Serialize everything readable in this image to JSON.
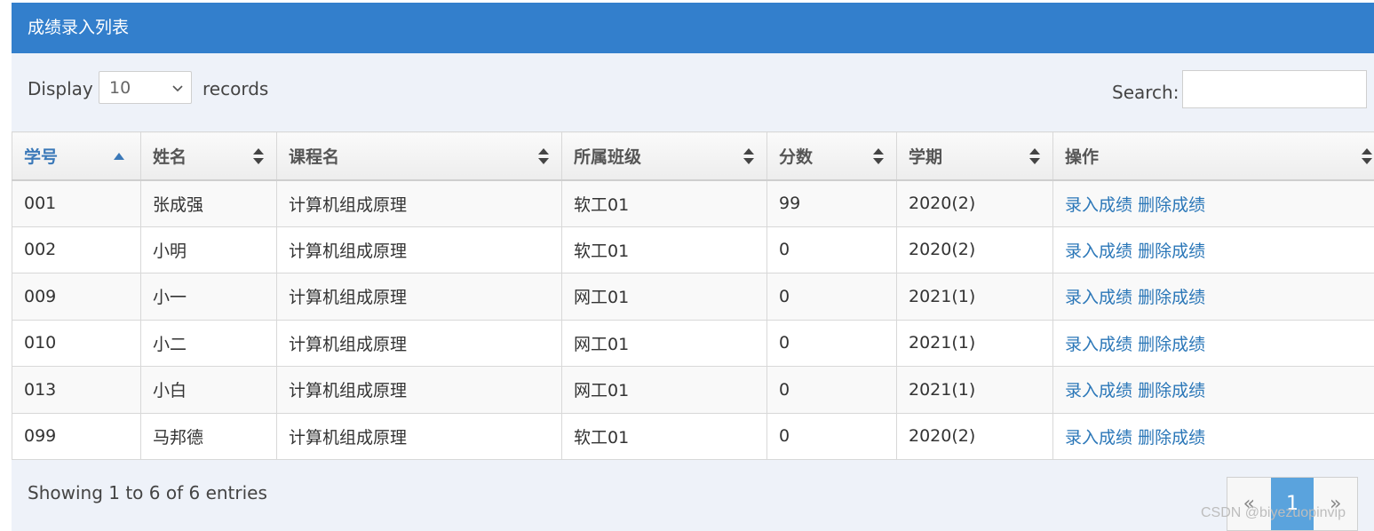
{
  "panel": {
    "title": "成绩录入列表"
  },
  "controls": {
    "display_label": "Display",
    "length_value": "10",
    "records_label": "records",
    "search_label": "Search:",
    "search_value": ""
  },
  "table": {
    "columns": [
      "学号",
      "姓名",
      "课程名",
      "所属班级",
      "分数",
      "学期",
      "操作"
    ],
    "sorted_column": "学号",
    "rows": [
      {
        "id": "001",
        "name": "张成强",
        "course": "计算机组成原理",
        "class": "软工01",
        "score": "99",
        "term": "2020(2)",
        "enter": "录入成绩",
        "delete": "删除成绩"
      },
      {
        "id": "002",
        "name": "小明",
        "course": "计算机组成原理",
        "class": "软工01",
        "score": "0",
        "term": "2020(2)",
        "enter": "录入成绩",
        "delete": "删除成绩"
      },
      {
        "id": "009",
        "name": "小一",
        "course": "计算机组成原理",
        "class": "网工01",
        "score": "0",
        "term": "2021(1)",
        "enter": "录入成绩",
        "delete": "删除成绩"
      },
      {
        "id": "010",
        "name": "小二",
        "course": "计算机组成原理",
        "class": "网工01",
        "score": "0",
        "term": "2021(1)",
        "enter": "录入成绩",
        "delete": "删除成绩"
      },
      {
        "id": "013",
        "name": "小白",
        "course": "计算机组成原理",
        "class": "网工01",
        "score": "0",
        "term": "2021(1)",
        "enter": "录入成绩",
        "delete": "删除成绩"
      },
      {
        "id": "099",
        "name": "马邦德",
        "course": "计算机组成原理",
        "class": "软工01",
        "score": "0",
        "term": "2020(2)",
        "enter": "录入成绩",
        "delete": "删除成绩"
      }
    ]
  },
  "footer": {
    "info": "Showing 1 to 6 of 6 entries",
    "pager": {
      "prev": "«",
      "current": "1",
      "next": "»"
    }
  },
  "watermark": "CSDN @biyezuopinvip",
  "colors": {
    "header_bg": "#337fcc",
    "link": "#2b77b8",
    "panel_bg": "#eef2f9",
    "active_page": "#5aa3dd"
  }
}
